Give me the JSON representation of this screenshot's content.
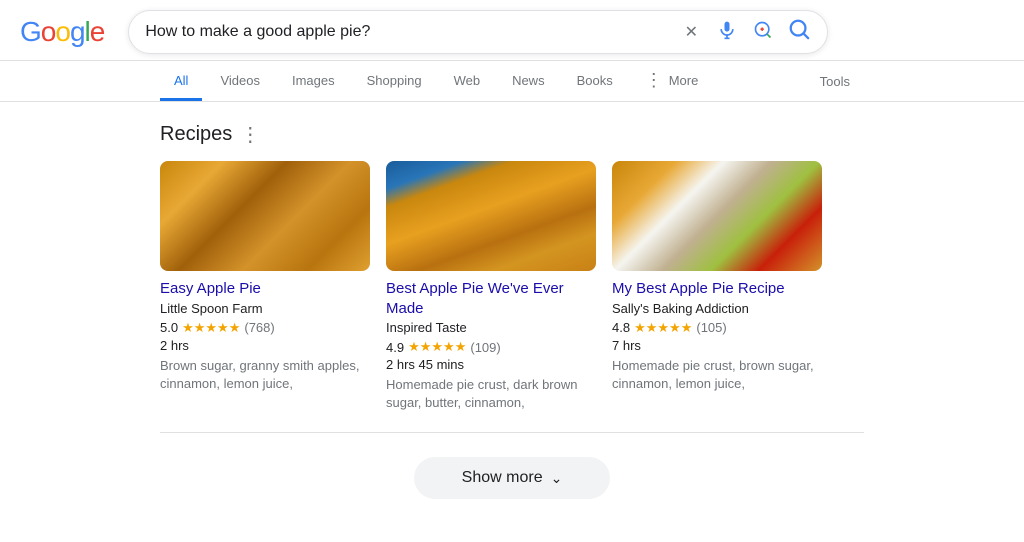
{
  "header": {
    "logo": {
      "g": "G",
      "o1": "o",
      "o2": "o",
      "g2": "g",
      "l": "l",
      "e": "e"
    },
    "search": {
      "value": "How to make a good apple pie?",
      "placeholder": "Search"
    },
    "icons": {
      "clear": "✕",
      "mic": "🎤",
      "lens": "⬡",
      "search": "🔍"
    }
  },
  "nav": {
    "tabs": [
      {
        "id": "all",
        "label": "All",
        "active": true
      },
      {
        "id": "videos",
        "label": "Videos",
        "active": false
      },
      {
        "id": "images",
        "label": "Images",
        "active": false
      },
      {
        "id": "shopping",
        "label": "Shopping",
        "active": false
      },
      {
        "id": "web",
        "label": "Web",
        "active": false
      },
      {
        "id": "news",
        "label": "News",
        "active": false
      },
      {
        "id": "books",
        "label": "Books",
        "active": false
      },
      {
        "id": "more",
        "label": "More",
        "active": false
      }
    ],
    "tools": "Tools"
  },
  "recipes": {
    "section_title": "Recipes",
    "cards": [
      {
        "id": "card1",
        "title": "Easy Apple Pie",
        "source": "Little Spoon Farm",
        "rating": "5.0",
        "stars": "★★★★★",
        "review_count": "(768)",
        "time": "2 hrs",
        "ingredients": "Brown sugar, granny smith apples, cinnamon, lemon juice,"
      },
      {
        "id": "card2",
        "title": "Best Apple Pie We've Ever Made",
        "source": "Inspired Taste",
        "rating": "4.9",
        "stars": "★★★★★",
        "review_count": "(109)",
        "time": "2 hrs 45 mins",
        "ingredients": "Homemade pie crust, dark brown sugar, butter, cinnamon,"
      },
      {
        "id": "card3",
        "title": "My Best Apple Pie Recipe",
        "source": "Sally's Baking Addiction",
        "rating": "4.8",
        "stars": "★★★★★",
        "review_count": "(105)",
        "time": "7 hrs",
        "ingredients": "Homemade pie crust, brown sugar, cinnamon, lemon juice,"
      }
    ]
  },
  "show_more": {
    "label": "Show more",
    "chevron": "⌄"
  }
}
